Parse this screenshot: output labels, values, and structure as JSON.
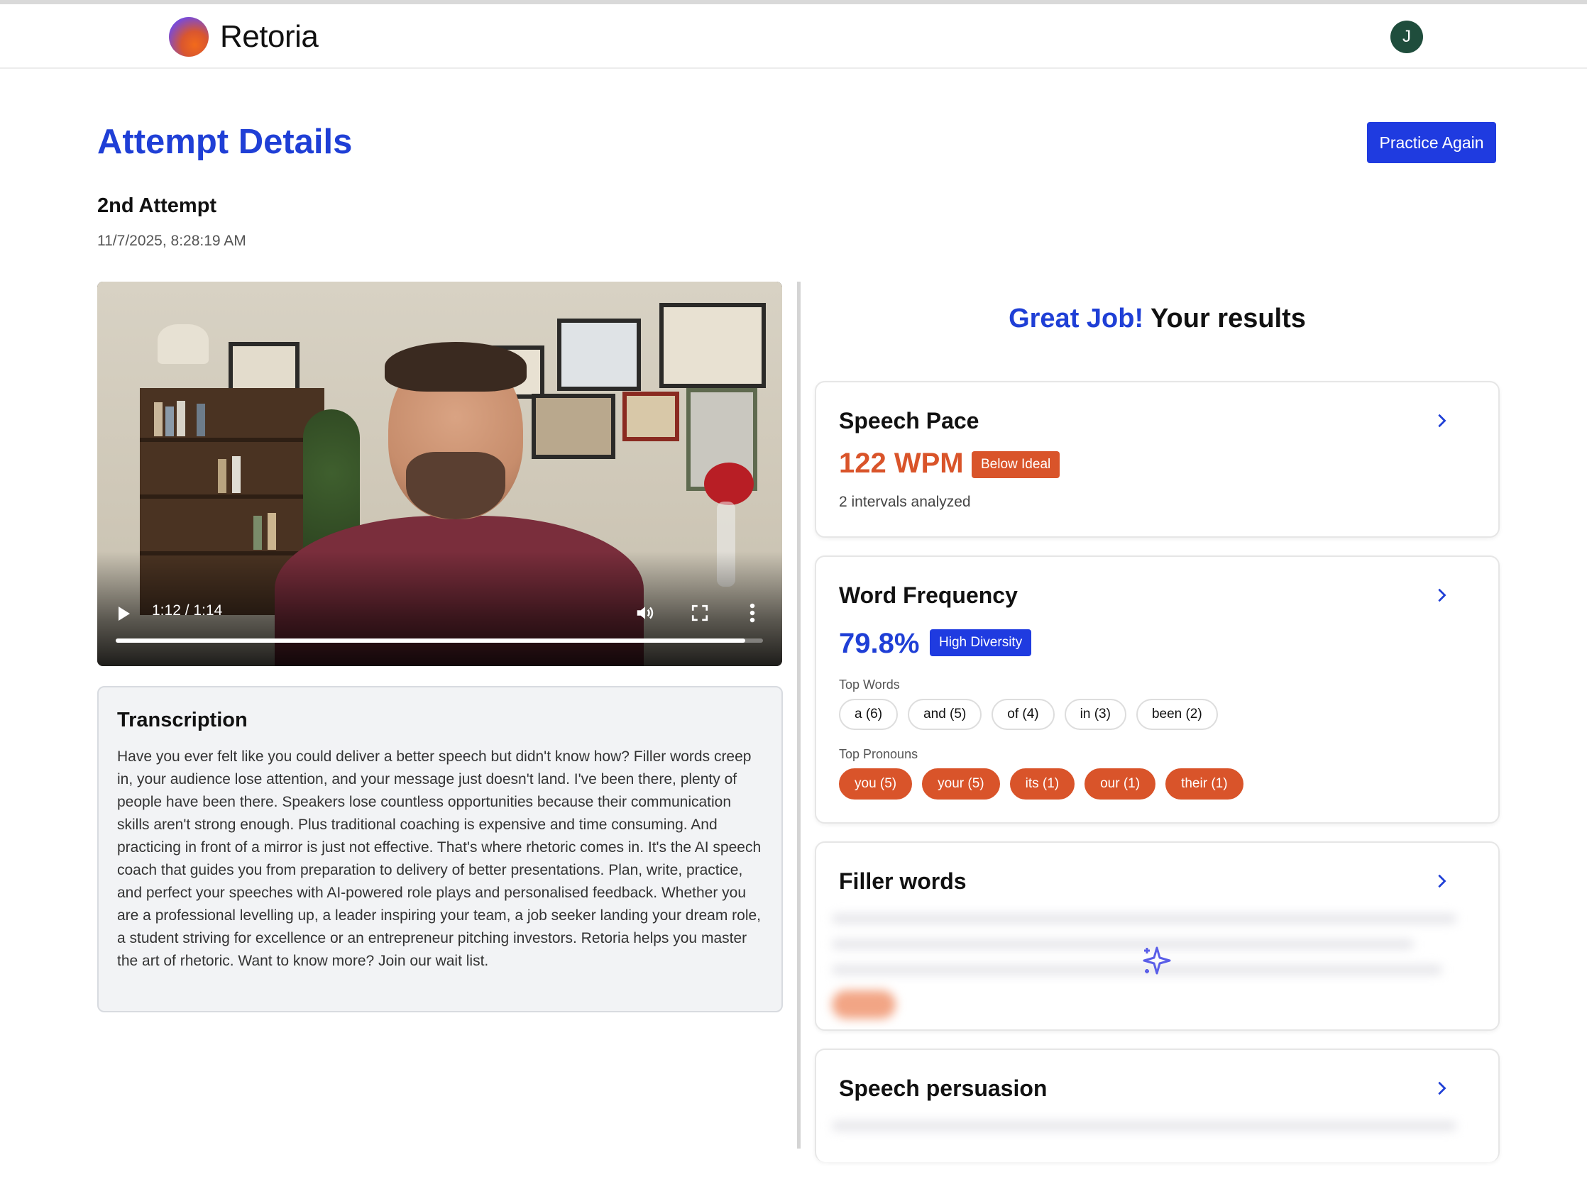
{
  "app": {
    "name": "Retoria",
    "user_initial": "J"
  },
  "page": {
    "title": "Attempt Details",
    "practice_button": "Practice Again",
    "attempt_label": "2nd Attempt",
    "attempt_date": "11/7/2025, 8:28:19 AM"
  },
  "video": {
    "time_display": "1:12 / 1:14",
    "progress_fraction": 0.973,
    "controls": [
      "play-icon",
      "volume-icon",
      "fullscreen-icon",
      "more-options-icon"
    ]
  },
  "transcription": {
    "title": "Transcription",
    "text": "Have you ever felt like you could deliver a better speech but didn't know how? Filler words creep in, your audience lose attention, and your message just doesn't land. I've been there, plenty of people have been there. Speakers lose countless opportunities because their communication skills aren't strong enough. Plus traditional coaching is expensive and time consuming. And practicing in front of a mirror is just not effective. That's where rhetoric comes in. It's the AI speech coach that guides you from preparation to delivery of better presentations. Plan, write, practice, and perfect your speeches with AI-powered role plays and personalised feedback. Whether you are a professional levelling up, a leader inspiring your team, a job seeker landing your dream role, a student striving for excellence or an entrepreneur pitching investors. Retoria helps you master the art of rhetoric. Want to know more? Join our wait list."
  },
  "results": {
    "heading_accent": "Great Job!",
    "heading_rest": " Your results",
    "speech_pace": {
      "title": "Speech Pace",
      "value": "122 WPM",
      "badge": "Below Ideal",
      "detail": "2 intervals analyzed"
    },
    "word_frequency": {
      "title": "Word Frequency",
      "value": "79.8%",
      "badge": "High Diversity",
      "top_words_label": "Top Words",
      "top_words": [
        "a (6)",
        "and (5)",
        "of (4)",
        "in (3)",
        "been (2)"
      ],
      "top_pronouns_label": "Top Pronouns",
      "top_pronouns": [
        "you (5)",
        "your (5)",
        "its (1)",
        "our (1)",
        "their (1)"
      ]
    },
    "filler_words": {
      "title": "Filler words"
    },
    "speech_persuasion": {
      "title": "Speech persuasion"
    }
  },
  "colors": {
    "brand_blue": "#1f3fd6",
    "button_blue": "#1f3be0",
    "accent_orange": "#d9542a",
    "avatar_green": "#1f4d3c"
  }
}
